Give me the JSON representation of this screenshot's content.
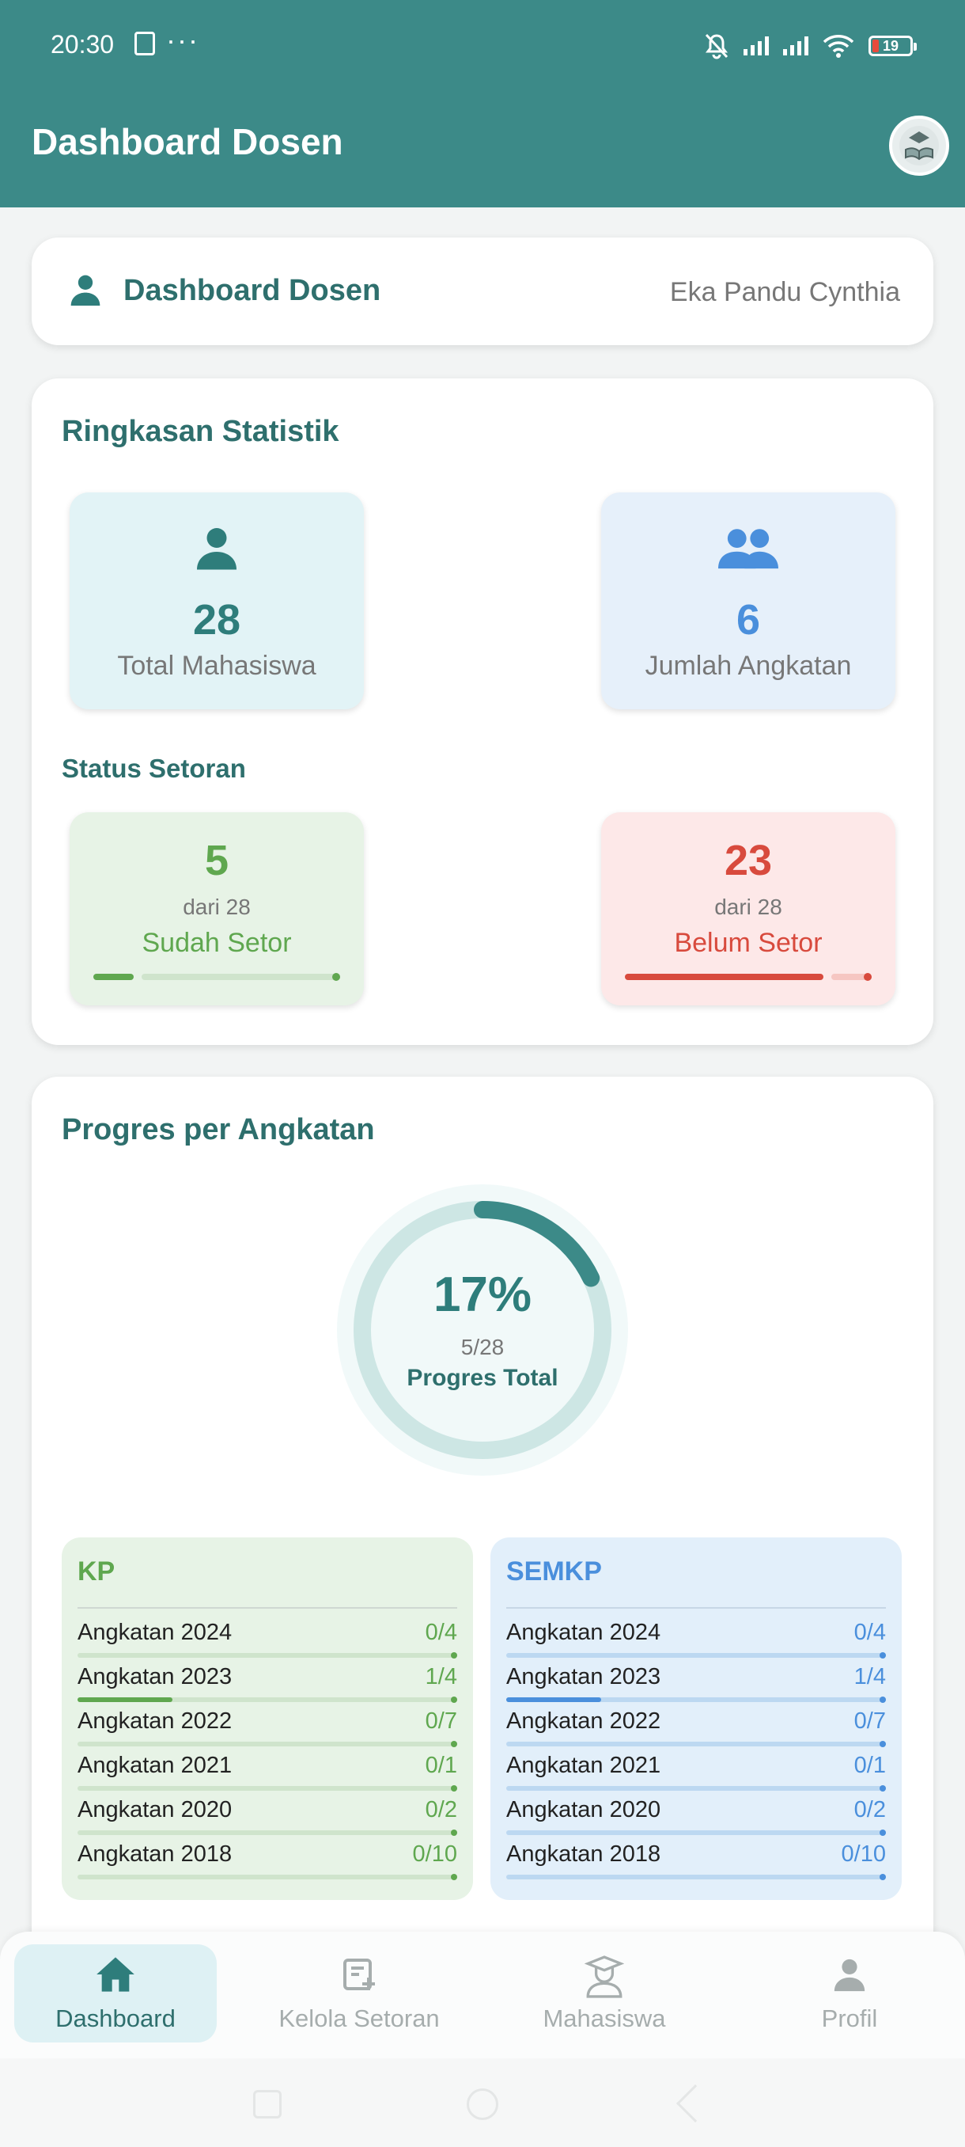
{
  "status_bar": {
    "time": "20:30",
    "battery": "19"
  },
  "app_bar": {
    "title": "Dashboard Dosen"
  },
  "welcome": {
    "title": "Dashboard Dosen",
    "name": "Eka Pandu Cynthia"
  },
  "stats": {
    "title": "Ringkasan Statistik",
    "total_mahasiswa": {
      "value": "28",
      "label": "Total Mahasiswa"
    },
    "jumlah_angkatan": {
      "value": "6",
      "label": "Jumlah Angkatan"
    },
    "status_title": "Status Setoran",
    "sudah": {
      "value": "5",
      "of": "dari 28",
      "label": "Sudah Setor",
      "fraction": 0.18
    },
    "belum": {
      "value": "23",
      "of": "dari 28",
      "label": "Belum Setor",
      "fraction": 0.82
    }
  },
  "progress": {
    "title": "Progres per Angkatan",
    "percent": "17%",
    "fraction_text": "5/28",
    "caption": "Progres Total",
    "fraction": 0.179,
    "kp": {
      "title": "KP",
      "rows": [
        {
          "label": "Angkatan 2024",
          "value": "0/4",
          "fraction": 0
        },
        {
          "label": "Angkatan 2023",
          "value": "1/4",
          "fraction": 0.25
        },
        {
          "label": "Angkatan 2022",
          "value": "0/7",
          "fraction": 0
        },
        {
          "label": "Angkatan 2021",
          "value": "0/1",
          "fraction": 0
        },
        {
          "label": "Angkatan 2020",
          "value": "0/2",
          "fraction": 0
        },
        {
          "label": "Angkatan 2018",
          "value": "0/10",
          "fraction": 0
        }
      ]
    },
    "semkp": {
      "title": "SEMKP",
      "rows": [
        {
          "label": "Angkatan 2024",
          "value": "0/4",
          "fraction": 0
        },
        {
          "label": "Angkatan 2023",
          "value": "1/4",
          "fraction": 0.25
        },
        {
          "label": "Angkatan 2022",
          "value": "0/7",
          "fraction": 0
        },
        {
          "label": "Angkatan 2021",
          "value": "0/1",
          "fraction": 0
        },
        {
          "label": "Angkatan 2020",
          "value": "0/2",
          "fraction": 0
        },
        {
          "label": "Angkatan 2018",
          "value": "0/10",
          "fraction": 0
        }
      ]
    }
  },
  "bottom_nav": {
    "items": [
      {
        "label": "Dashboard",
        "icon": "home-icon",
        "active": true
      },
      {
        "label": "Kelola Setoran",
        "icon": "add-note-icon",
        "active": false
      },
      {
        "label": "Mahasiswa",
        "icon": "student-icon",
        "active": false
      },
      {
        "label": "Profil",
        "icon": "person-icon",
        "active": false
      }
    ]
  },
  "colors": {
    "primary": "#3c8a88",
    "success": "#5fa74f",
    "danger": "#d84a3d",
    "info": "#4a8fdc"
  }
}
